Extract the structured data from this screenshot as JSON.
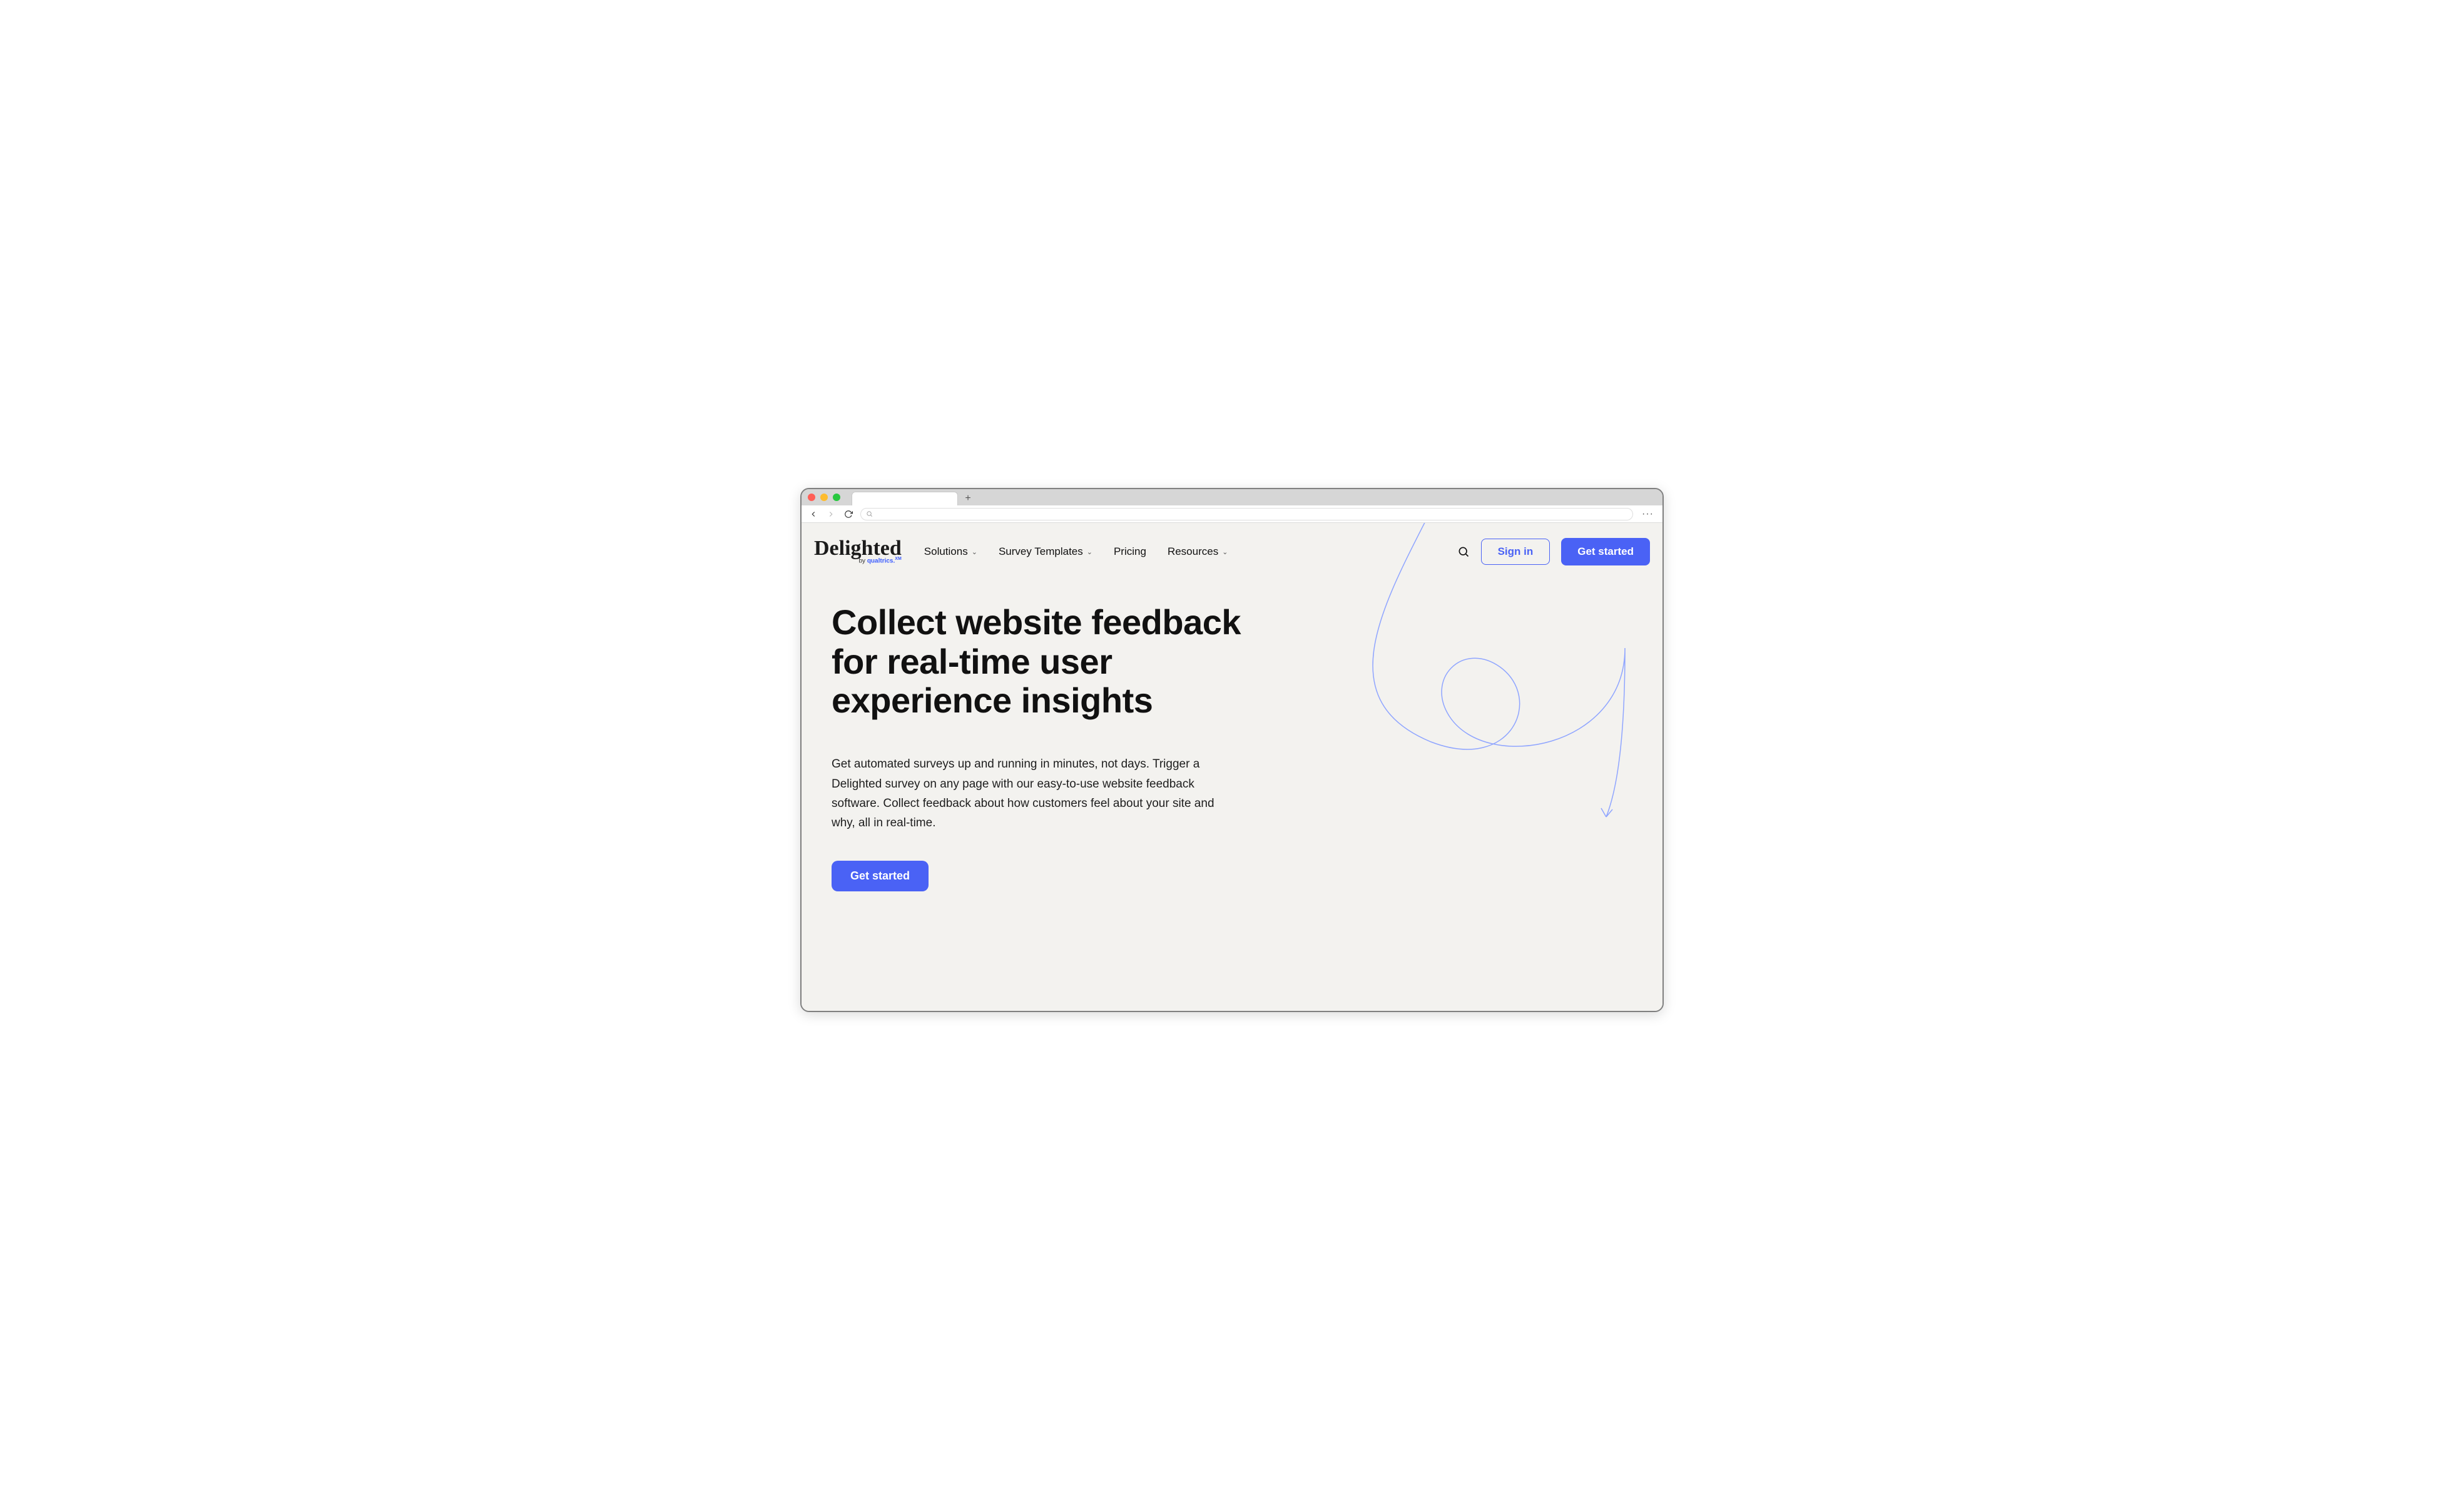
{
  "browser": {
    "new_tab_label": "+",
    "menu_label": "···"
  },
  "logo": {
    "name": "Delighted",
    "subline_prefix": "by ",
    "subline_brand": "qualtrics.",
    "subline_suffix": "XM"
  },
  "nav": {
    "items": [
      {
        "label": "Solutions",
        "has_dropdown": true
      },
      {
        "label": "Survey Templates",
        "has_dropdown": true
      },
      {
        "label": "Pricing",
        "has_dropdown": false
      },
      {
        "label": "Resources",
        "has_dropdown": true
      }
    ]
  },
  "header_actions": {
    "signin": "Sign in",
    "get_started": "Get started"
  },
  "hero": {
    "title": "Collect website feedback for real-time user experience insights",
    "body": "Get automated surveys up and running in minutes, not days. Trigger a Delighted survey on any page with our easy-to-use website feedback software. Collect feedback about how customers feel about your site and why, all in real-time.",
    "cta": "Get started"
  },
  "colors": {
    "accent": "#4a62f5",
    "page_bg": "#f3f2ef",
    "text": "#111111"
  }
}
